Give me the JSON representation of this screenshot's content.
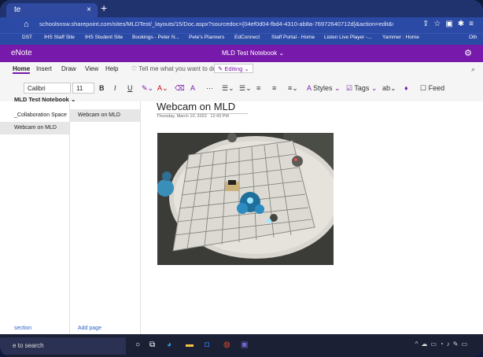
{
  "browser": {
    "tab_title": "te",
    "tab_close": "×",
    "new_tab": "+",
    "url": "schoolsnsw.sharepoint.com/sites/MLDTest/_layouts/15/Doc.aspx?sourcedoc={04ef0d04-fbd4-4310-ab8a-76972640712d}&action=edit&wd=target%28_Collabo...",
    "bookmarks": [
      "DST",
      "IHS Staff Site",
      "IHS Student Site",
      "Bookings - Peter N...",
      "Pete's Planners",
      "EdConnect",
      "Staff Portal - Home",
      "Listen Live Player -...",
      "Yammer : Home",
      "Oth"
    ]
  },
  "app": {
    "name": "eNote",
    "notebook_title": "MLD Test Notebook",
    "gear_icon": "gear-icon"
  },
  "ribbon": {
    "tabs": [
      "Home",
      "Insert",
      "Draw",
      "View",
      "Help"
    ],
    "search_placeholder": "Tell me what you want to do",
    "editing_label": "Editing",
    "font_name": "Calibri",
    "font_size": "11",
    "styles_label": "Styles",
    "tags_label": "Tags",
    "feed_label": "Feed"
  },
  "sidebar": {
    "notebook_name": "MLD Test Notebook",
    "sections": [
      "_Collaboration Space",
      "Webcam on MLD"
    ],
    "pages": [
      "Webcam on MLD"
    ],
    "add_section": "section",
    "add_page": "Add page"
  },
  "page": {
    "title": "Webcam on MLD",
    "date": "Thursday, March 10, 2022",
    "time": "12:43 PM"
  },
  "taskbar": {
    "search_text": "e to search"
  }
}
